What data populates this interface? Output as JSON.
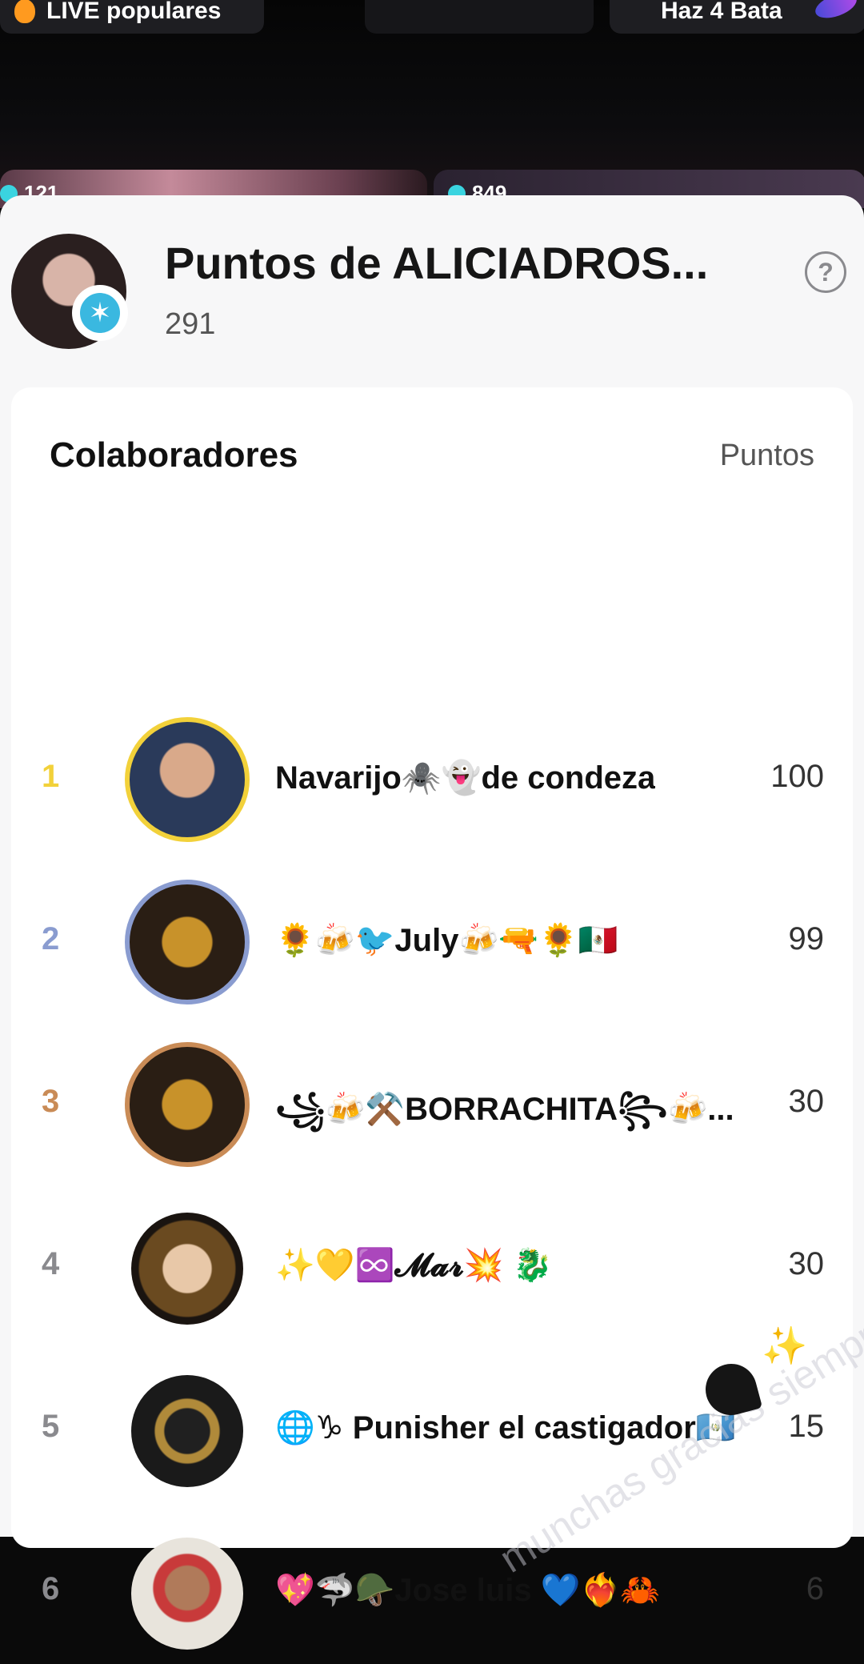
{
  "top_strip": {
    "pill_left": "LIVE populares",
    "pill_right": "Haz 4 Bata",
    "viewer_left": "121",
    "viewer_right": "849"
  },
  "host": {
    "title": "Puntos de ALICIADROS...",
    "points": "291",
    "help_icon": "?"
  },
  "list_header": {
    "left": "Colaboradores",
    "right": "Puntos"
  },
  "rows": [
    {
      "rank": "1",
      "name": "Navarijo🕷️👻de condeza",
      "points": "100",
      "rank_color": "#f2d13a"
    },
    {
      "rank": "2",
      "name": "🌻🍻🐦July🍻🔫🌻🇲🇽",
      "points": "99",
      "rank_color": "#8a9cd0"
    },
    {
      "rank": "3",
      "name": "꧁🍻⚒️BORRACHITA꧂🍻...",
      "points": "30",
      "rank_color": "#c98b56"
    },
    {
      "rank": "4",
      "name": "✨💛♾️𝓜𝓪𝓻💥 🐉",
      "points": "30",
      "rank_color": "#8a8a8e"
    },
    {
      "rank": "5",
      "name": "🌐♑ Punisher el castigador🇬🇹",
      "points": "15",
      "rank_color": "#8a8a8e"
    },
    {
      "rank": "6",
      "name": "💖🦈🪖Jose luis 💙❤️‍🔥🦀",
      "points": "6",
      "rank_color": "#8a8a8e"
    }
  ],
  "overlay_text": "munchas gracias siempre firme ala orden"
}
